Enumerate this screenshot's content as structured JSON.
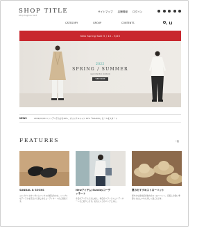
{
  "header": {
    "logo": "SHOP TITLE",
    "logo_sub": "shop tagline text",
    "top_links": [
      "サイトマップ",
      "店舗情報",
      "ログイン"
    ]
  },
  "nav": {
    "items": [
      "CATEGORY",
      "GROUP",
      "CONTENTS"
    ]
  },
  "banner": {
    "text": "New Spring Sale 5 / 10 - 5/20"
  },
  "hero": {
    "year": "2022",
    "title": "SPRING / SUMMER",
    "subtitle": "new collection lookbook",
    "button": "VIEW MORE"
  },
  "news": {
    "label": "NEWS",
    "text": "2019/XX/XX ニットアイテムから20%、オリジナルシャツ 10%「ACLOCK」セールをスタート"
  },
  "features": {
    "title": "FEATURES",
    "more": "一覧",
    "cards": [
      {
        "title": "SANDAL & SOCKS",
        "title2": "",
        "desc": "コンパクトなサンダルとソックスの組み合わせ。シンプルなアイテムを足元から楽しめるコーディネートのご提案です。"
      },
      {
        "title": "Newアイテム!Sundayコーデ",
        "title2": "ィネート",
        "desc": "今日のアイテムでまとめた、休日のリラックスコーディネートをご紹介します。お気に入りのバッグと共に。"
      },
      {
        "title": "夏のおすすめストローハット",
        "title2": "",
        "desc": "軽やかな素材感が魅力のストローハット。日差しの強い季節にもおしゃれに涼しく過ごせます。"
      }
    ]
  },
  "colors": {
    "banner": "#c8272e",
    "accent": "#3fa9a0",
    "text": "#333333"
  }
}
